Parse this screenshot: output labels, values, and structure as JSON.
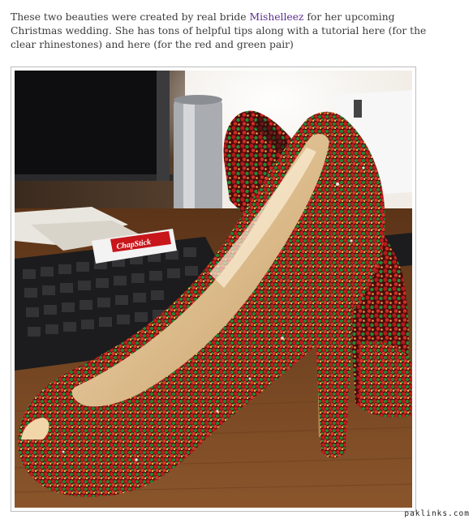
{
  "post": {
    "text_before_link": "These two beauties were created by real bride ",
    "link_text": "Mishelleez",
    "text_after_link": " for her upcoming Christmas wedding. She has tons of helpful tips along with a tutorial here (for the clear rhinestones) and here (for the red and green pair)"
  },
  "photo": {
    "chapstick_label": "ChapStick",
    "colors": {
      "rhinestone_red": "#c41e1e",
      "rhinestone_green": "#1f8a35",
      "rhinestone_gold": "#d9a441",
      "insole": "#e6c99a",
      "desk": "#7a4a26"
    }
  },
  "watermark": "paklinks.com"
}
